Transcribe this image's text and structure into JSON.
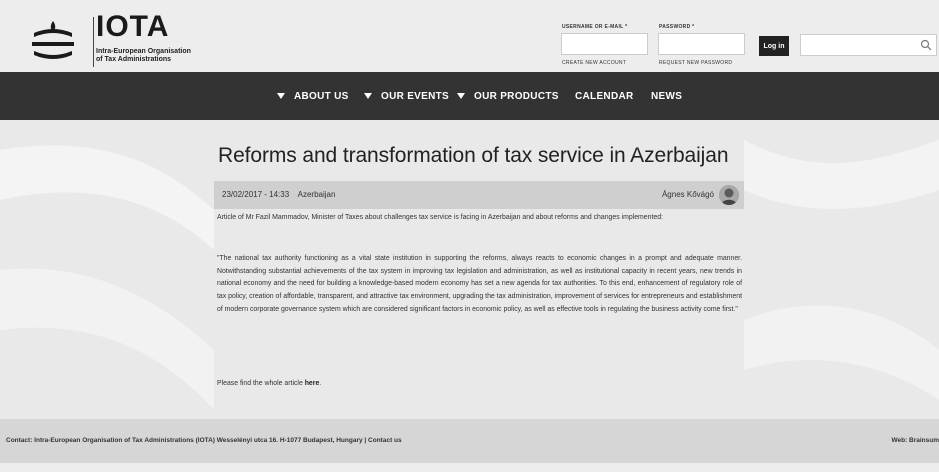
{
  "header": {
    "logo_title": "IOTA",
    "logo_subtitle_line1": "Intra-European Organisation",
    "logo_subtitle_line2": "of Tax Administrations",
    "login": {
      "username_label": "USERNAME OR E-MAIL *",
      "password_label": "PASSWORD *",
      "create_account": "CREATE NEW ACCOUNT",
      "request_password": "REQUEST NEW PASSWORD",
      "login_button": "Log in"
    },
    "search_icon": "search-icon"
  },
  "nav": {
    "items": [
      {
        "label": "ABOUT US",
        "dropdown": true
      },
      {
        "label": "OUR EVENTS",
        "dropdown": true
      },
      {
        "label": "OUR PRODUCTS",
        "dropdown": true
      },
      {
        "label": "CALENDAR",
        "dropdown": false
      },
      {
        "label": "NEWS",
        "dropdown": false
      }
    ]
  },
  "article": {
    "title": "Reforms and transformation of tax service in Azerbaijan",
    "date": "23/02/2017 - 14:33",
    "tag": "Azerbaijan",
    "author": "Ágnes Kővágó",
    "intro": "Article of Mr Fazil Mammadov, Minister of Taxes about challenges tax service is facing in Azerbaijan and about reforms and changes implemented:",
    "quote": "\"The national tax authority functioning as a vital state institution in supporting the reforms, always reacts to economic changes in a prompt and adequate manner. Notwithstanding substantial achievements of the tax system in improving tax legislation and administration, as well as institutional capacity in recent years, new trends in national economy and the need for building a knowledge-based modern economy has set a new agenda for tax authorities. To this end, enhancement of regulatory role of tax policy, creation of affordable, transparent, and attractive tax environment, upgrading the tax administration, improvement of services for entrepreneurs and establishment of modern corporate governance system which are considered significant factors in economic policy, as well as effective tools in regulating the business activity come first.\"",
    "link_prefix": "Please find the whole article ",
    "link_text": "here",
    "link_suffix": "."
  },
  "footer": {
    "contact_text": "Contact: Intra-European Organisation of Tax Administrations (IOTA) Wesselényi utca 16. H-1077 Budapest, Hungary  | ",
    "contact_link": "Contact us",
    "web_text": "Web: Brainsum"
  },
  "colors": {
    "nav_bg": "#333333",
    "footer_bg": "#d6d6d6",
    "meta_bar_bg": "#cfcfcf",
    "page_bg": "#ececec"
  }
}
